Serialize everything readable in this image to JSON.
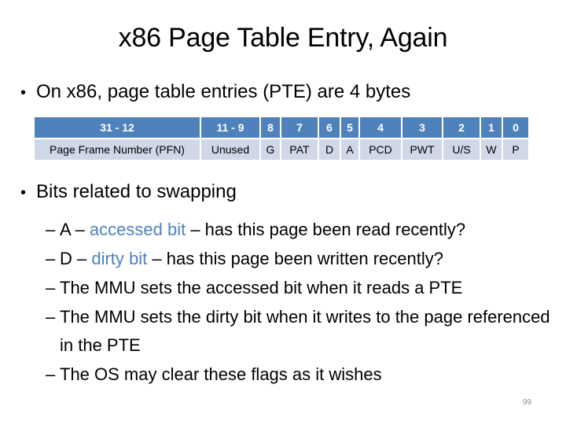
{
  "slide": {
    "title": "x86 Page Table Entry, Again",
    "page_number": "99",
    "accent_color": "#4F81BD"
  },
  "bullets": [
    {
      "marker": "•",
      "text": "On x86, page table entries (PTE) are 4 bytes"
    },
    {
      "marker": "•",
      "text": "Bits related to swapping"
    }
  ],
  "pte_table": {
    "colors": {
      "header_bg": "#4F81BD",
      "header_text": "#FFFFFF",
      "body_bg": "#D0D8E8",
      "body_text": "#000000"
    },
    "bit_ranges": [
      "31 - 12",
      "11 - 9",
      "8",
      "7",
      "6",
      "5",
      "4",
      "3",
      "2",
      "1",
      "0"
    ],
    "fields": [
      "Page Frame Number (PFN)",
      "Unused",
      "G",
      "PAT",
      "D",
      "A",
      "PCD",
      "PWT",
      "U/S",
      "W",
      "P"
    ]
  },
  "sub_items": [
    {
      "dash": "–",
      "prefix": "A – ",
      "highlight": "accessed bit",
      "suffix": " – has this page been read recently?"
    },
    {
      "dash": "–",
      "prefix": "D – ",
      "highlight": "dirty bit",
      "suffix": " – has this page been written recently?"
    },
    {
      "dash": "–",
      "prefix": "The MMU sets the accessed bit when it reads a PTE",
      "highlight": "",
      "suffix": ""
    },
    {
      "dash": "–",
      "prefix": "The MMU sets the dirty bit when it writes to the page referenced in the PTE",
      "highlight": "",
      "suffix": ""
    },
    {
      "dash": "–",
      "prefix": "The OS may clear these flags as it wishes",
      "highlight": "",
      "suffix": ""
    }
  ]
}
